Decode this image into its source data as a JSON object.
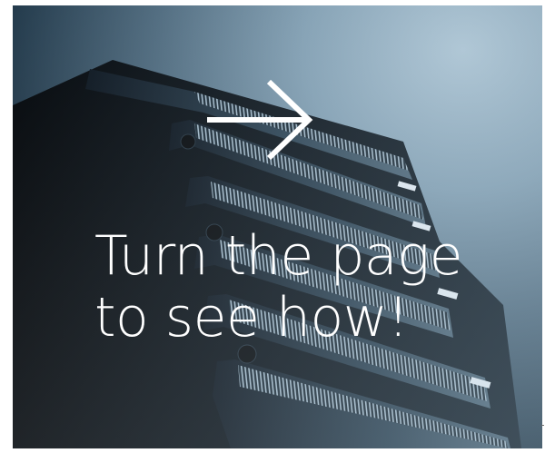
{
  "headline": {
    "line1": "Turn the page",
    "line2": "to see how!"
  },
  "icons": {
    "arrow": "arrow-right-icon",
    "hero": "server-rack-image"
  },
  "colors": {
    "text": "#ffffff",
    "highlight": "#a9c2d2",
    "shadow": "#0f1c27"
  }
}
